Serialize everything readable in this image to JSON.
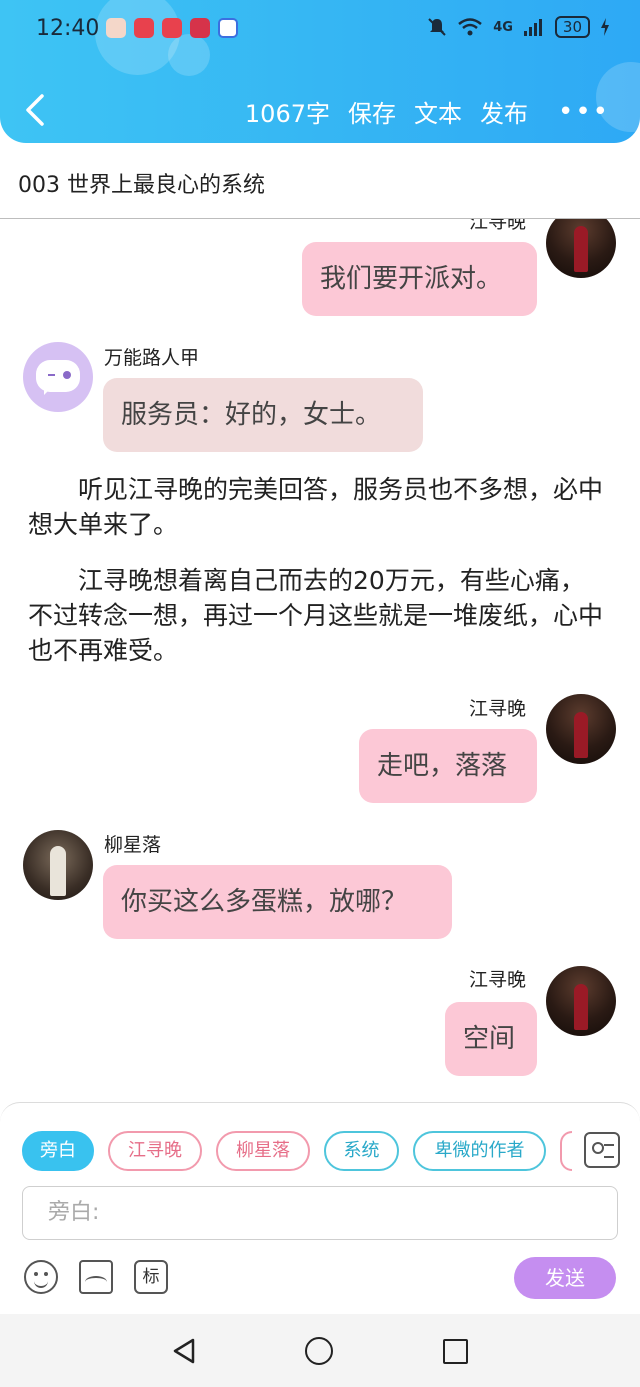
{
  "status_bar": {
    "time": "12:40",
    "network": "4G",
    "battery": "30"
  },
  "nav": {
    "word_count": "1067字",
    "save": "保存",
    "text": "文本",
    "publish": "发布",
    "more": "•••"
  },
  "chapter": {
    "title": "003 世界上最良心的系统"
  },
  "messages": {
    "m1": {
      "name": "江寻晚",
      "text": "我们要开派对。"
    },
    "m2": {
      "name": "万能路人甲",
      "text": "服务员：好的，女士。"
    },
    "n1": {
      "text": "听见江寻晚的完美回答，服务员也不多想，必中想大单来了。"
    },
    "n2": {
      "text": "江寻晚想着离自己而去的20万元，有些心痛，不过转念一想，再过一个月这些就是一堆废纸，心中也不再难受。"
    },
    "m3": {
      "name": "江寻晚",
      "text": "走吧，落落"
    },
    "m4": {
      "name": "柳星落",
      "text": "你买这么多蛋糕，放哪？"
    },
    "m5": {
      "name": "江寻晚",
      "text": "空间"
    }
  },
  "roles": [
    "旁白",
    "江寻晚",
    "柳星落",
    "系统",
    "卑微的作者"
  ],
  "input": {
    "placeholder": "旁白:"
  },
  "tools": {
    "mark": "标",
    "send": "发送"
  },
  "colors": {
    "header": "#35b5f3",
    "bubble_pink": "#fcc8d6",
    "bubble_beige": "#f1dcdc",
    "send": "#c58ef0"
  }
}
